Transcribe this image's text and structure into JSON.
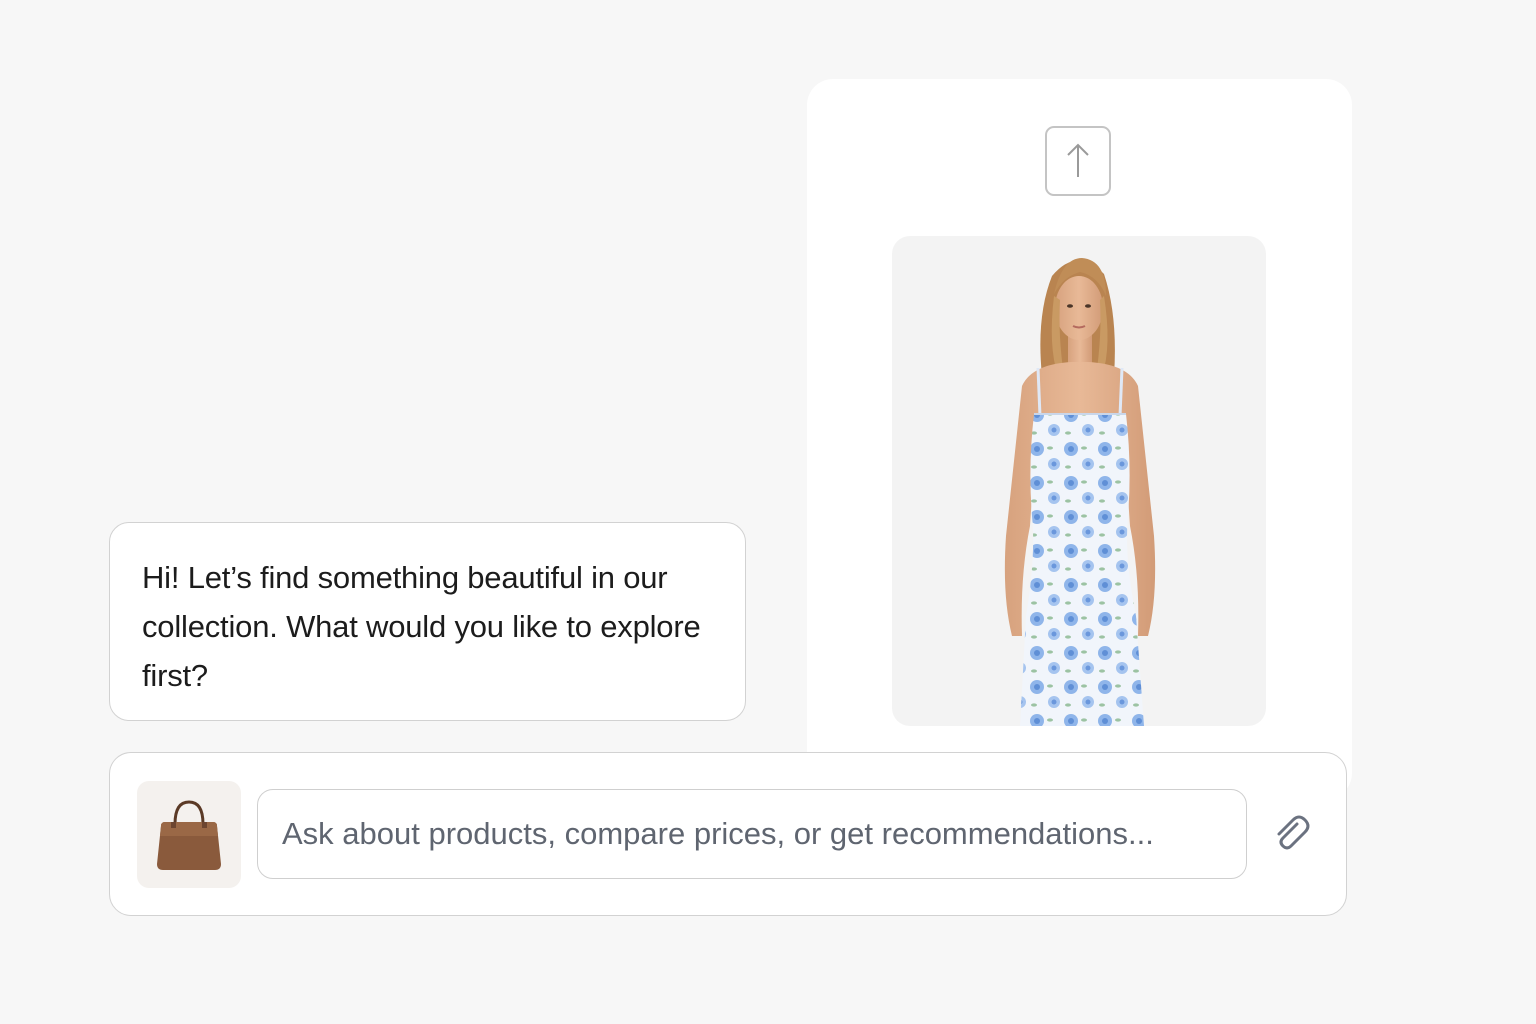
{
  "assistant_message": {
    "text": "Hi! Let’s find something beautiful in our collection. What would you like to explore first?"
  },
  "composer": {
    "placeholder": "Ask about products, compare prices, or get recommendations..."
  },
  "icons": {
    "upload": "arrow-up-icon",
    "attach": "paperclip-icon",
    "thumbnail": "handbag-icon"
  },
  "colors": {
    "background": "#f7f7f7",
    "panel": "#ffffff",
    "border": "#d2d2d2",
    "icon_gray": "#6b7280",
    "handbag_brown": "#8a5a3c",
    "dress_blue": "#7aa6e0"
  }
}
